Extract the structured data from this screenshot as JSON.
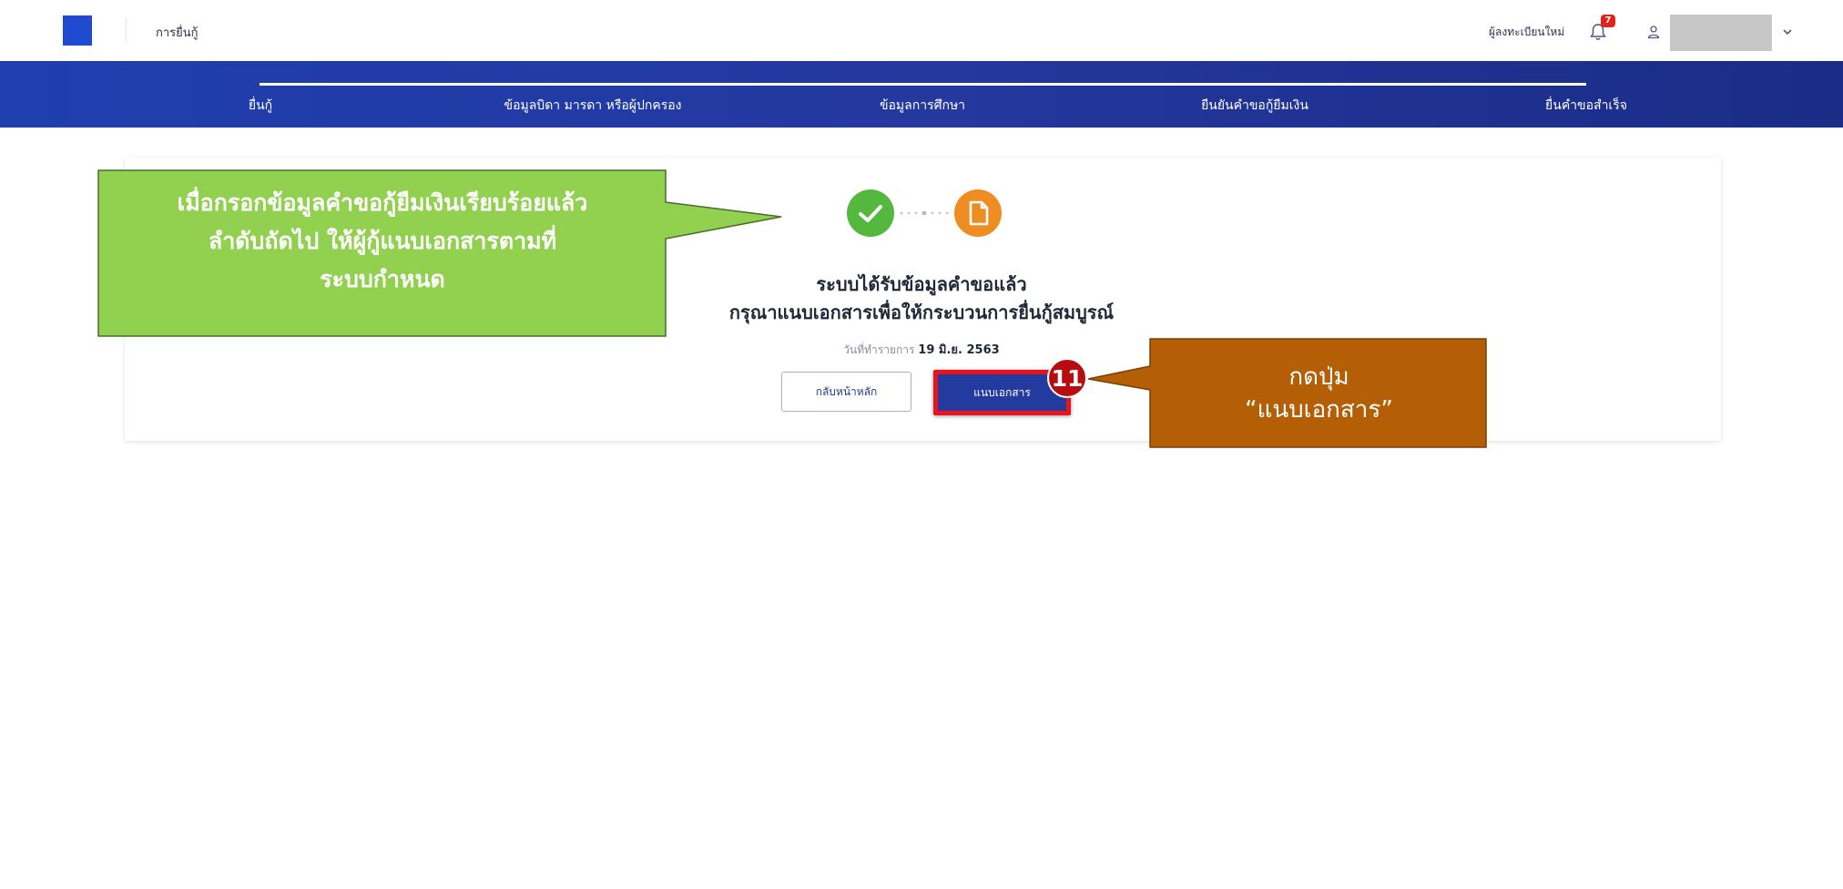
{
  "header": {
    "app_title": "การยื่นกู้",
    "register_link": "ผู้ลงทะเบียนใหม่",
    "notification_count": "7",
    "icons": [
      "logo",
      "bell-icon",
      "user-icon",
      "chevron-down-icon"
    ],
    "brand_color": "#1f4bd1"
  },
  "stepper": {
    "steps": [
      {
        "label": "ยื่นกู้"
      },
      {
        "label": "ข้อมูลบิดา มารดา หรือผู้ปกครอง"
      },
      {
        "label": "ข้อมูลการศึกษา"
      },
      {
        "label": "ยืนยันคำขอกู้ยืมเงิน"
      },
      {
        "label": "ยื่นคำขอสำเร็จ"
      }
    ],
    "band_color": "#24389e"
  },
  "result": {
    "message_line1": "ระบบได้รับข้อมูลคำขอแล้ว",
    "message_line2": "กรุณาแนบเอกสารเพื่อให้กระบวนการยื่นกู้สมบูรณ์",
    "date_label": "วันที่ทำรายการ",
    "date_value": "19 มิ.ย. 2563",
    "home_button": "กลับหน้าหลัก",
    "attach_button": "แนบเอกสาร",
    "status_icons": [
      "check-icon",
      "document-icon"
    ],
    "success_color": "#55b83e",
    "pending_color": "#ee8d21"
  },
  "annotations": {
    "step_number": "11",
    "green_callout": [
      "เมื่อกรอกข้อมูลคำขอกู้ยืมเงินเรียบร้อยแล้ว",
      "ลำดับถัดไป ให้ผู้กู้แนบเอกสารตามที่",
      "ระบบกำหนด"
    ],
    "brown_callout": [
      "กดปุ่ม",
      "“แนบเอกสาร”"
    ],
    "green_color": "#92d050",
    "brown_color": "#b45f06"
  }
}
